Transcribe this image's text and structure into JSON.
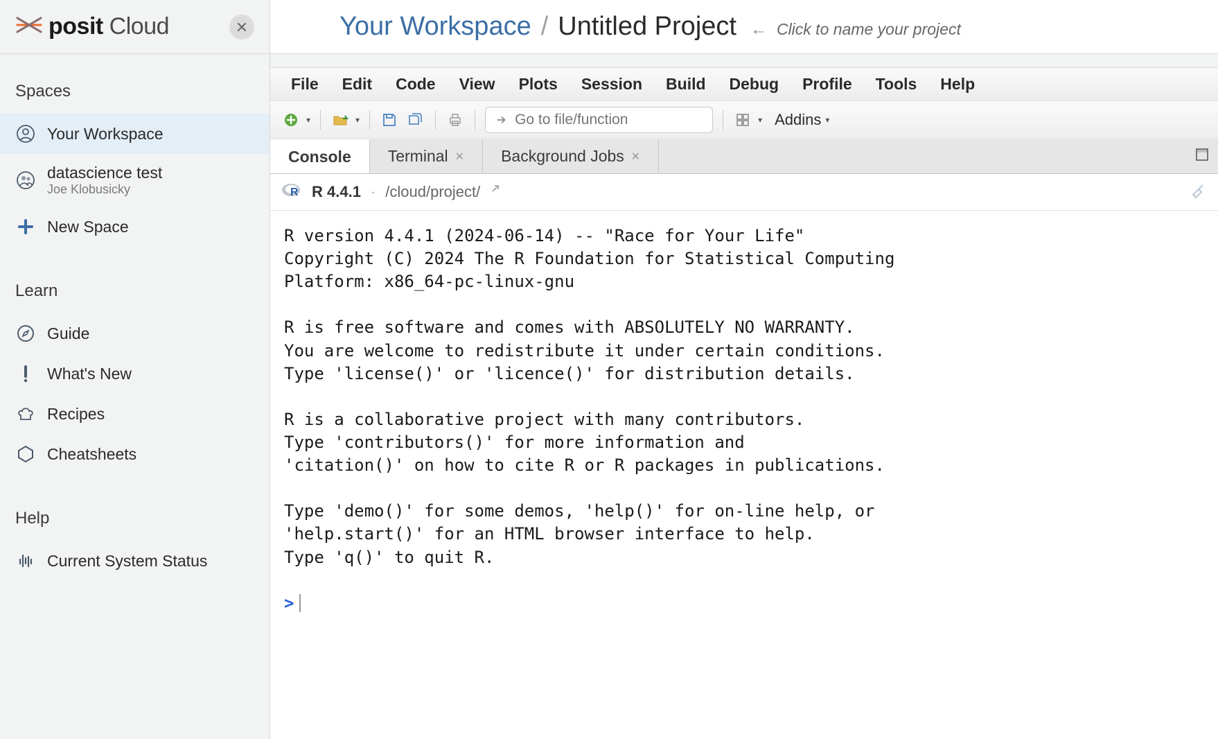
{
  "header": {
    "logo_bold": "posit",
    "logo_light": "Cloud",
    "breadcrumb_workspace": "Your Workspace",
    "breadcrumb_sep": "/",
    "breadcrumb_project": "Untitled Project",
    "breadcrumb_hint": "Click to name your project"
  },
  "sidebar": {
    "sections": {
      "spaces": "Spaces",
      "learn": "Learn",
      "help": "Help"
    },
    "items": {
      "your_workspace": "Your Workspace",
      "ds_test": "datascience test",
      "ds_test_owner": "Joe Klobusicky",
      "new_space": "New Space",
      "guide": "Guide",
      "whats_new": "What's New",
      "recipes": "Recipes",
      "cheatsheets": "Cheatsheets",
      "system_status": "Current System Status"
    }
  },
  "menubar": {
    "file": "File",
    "edit": "Edit",
    "code": "Code",
    "view": "View",
    "plots": "Plots",
    "session": "Session",
    "build": "Build",
    "debug": "Debug",
    "profile": "Profile",
    "tools": "Tools",
    "help": "Help"
  },
  "toolbar": {
    "goto_placeholder": "Go to file/function",
    "addins": "Addins"
  },
  "tabs": {
    "console": "Console",
    "terminal": "Terminal",
    "background": "Background Jobs"
  },
  "console_header": {
    "r_version": "R 4.4.1",
    "dot": "·",
    "path": "/cloud/project/"
  },
  "console": {
    "output": "R version 4.4.1 (2024-06-14) -- \"Race for Your Life\"\nCopyright (C) 2024 The R Foundation for Statistical Computing\nPlatform: x86_64-pc-linux-gnu\n\nR is free software and comes with ABSOLUTELY NO WARRANTY.\nYou are welcome to redistribute it under certain conditions.\nType 'license()' or 'licence()' for distribution details.\n\nR is a collaborative project with many contributors.\nType 'contributors()' for more information and\n'citation()' on how to cite R or R packages in publications.\n\nType 'demo()' for some demos, 'help()' for on-line help, or\n'help.start()' for an HTML browser interface to help.\nType 'q()' to quit R.\n",
    "prompt": ">"
  }
}
